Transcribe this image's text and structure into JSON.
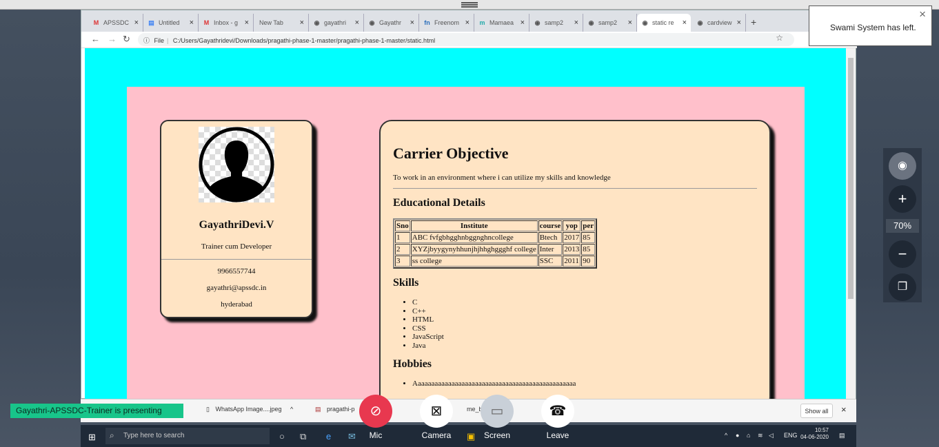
{
  "browser": {
    "tabs": [
      {
        "label": "APSSDC",
        "icon": "M"
      },
      {
        "label": "Untitled",
        "icon": "▤"
      },
      {
        "label": "Inbox - g",
        "icon": "M"
      },
      {
        "label": "New Tab",
        "icon": ""
      },
      {
        "label": "gayathri",
        "icon": "◉"
      },
      {
        "label": "Gayathr",
        "icon": "◉"
      },
      {
        "label": "Freenom",
        "icon": "fn"
      },
      {
        "label": "Mamaea",
        "icon": "m"
      },
      {
        "label": "samp2",
        "icon": "◉"
      },
      {
        "label": "samp2",
        "icon": "◉"
      },
      {
        "label": "static re",
        "icon": "◉"
      },
      {
        "label": "cardview",
        "icon": "◉"
      }
    ],
    "file_label": "File",
    "url": "C:/Users/Gayathridevi/Downloads/pragathi-phase-1-master/pragathi-phase-1-master/static.html"
  },
  "profile": {
    "name": "GayathriDevi.V",
    "title": "Trainer cum Developer",
    "phone": "9966557744",
    "email": "gayathri@apssdc.in",
    "city": "hyderabad"
  },
  "resume": {
    "objective_heading": "Carrier Objective",
    "objective_text": "To work in an environment where i can utilize my skills and knowledge",
    "education_heading": "Educational Details",
    "education_columns": [
      "Sno",
      "Institute",
      "course",
      "yop",
      "per"
    ],
    "education_rows": [
      [
        "1",
        "ABC fvfgbhgghnbggnghncollege",
        "Btech",
        "2017",
        "85"
      ],
      [
        "2",
        "XYZjbyygynyhhunjhjhhghggghf college",
        "Inter",
        "2013",
        "85"
      ],
      [
        "3",
        "ss college",
        "SSC",
        "2011",
        "90"
      ]
    ],
    "skills_heading": "Skills",
    "skills": [
      "C",
      "C++",
      "HTML",
      "CSS",
      "JavaScript",
      "Java"
    ],
    "hobbies_heading": "Hobbies",
    "hobbies": [
      "Aaaaaaaaaaaaaaaaaaaaaaaaaaaaaaaaaaaaaaaaaaaaaaaa"
    ]
  },
  "downloads": {
    "items": [
      "WhatsApp Image....jpeg",
      "pragathi-p",
      "me_builde"
    ],
    "show_all": "Show all"
  },
  "taskbar": {
    "search_placeholder": "Type here to search",
    "lang": "ENG",
    "time": "10:57",
    "date": "04-06-2020"
  },
  "meeting": {
    "presenting": "Gayathri-APSSDC-Trainer is presenting",
    "controls": [
      "Mic",
      "Camera",
      "Screen",
      "Leave"
    ],
    "toast": "Swami System has left.",
    "zoom": "70%"
  },
  "colors": {
    "page_bg": "#00ffff",
    "container_bg": "#ffc0cb",
    "card_bg": "#ffe4c4",
    "mic_button": "#e8384f",
    "presenting_badge": "#18c58a"
  }
}
